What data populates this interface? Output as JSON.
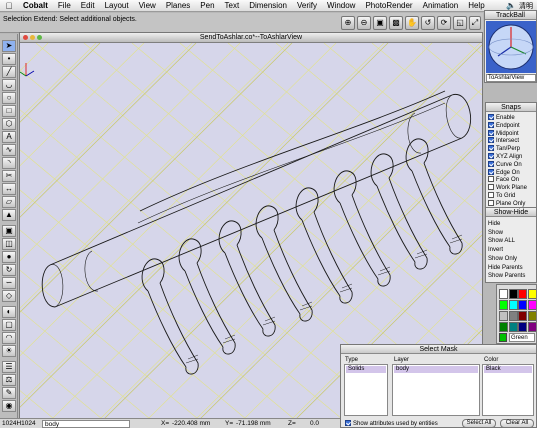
{
  "menubar": {
    "apple": "",
    "app": "Cobalt",
    "items": [
      "File",
      "Edit",
      "Layout",
      "View",
      "Planes",
      "Pen",
      "Text",
      "Dimension",
      "Verify",
      "Window",
      "PhotoRender",
      "Animation",
      "Help"
    ],
    "user": "清明"
  },
  "status": {
    "message": "Selection Extend: Select additional objects."
  },
  "window": {
    "title": "SendToAshlar.co*--ToAshlarView"
  },
  "trackball": {
    "title": "TrackBall",
    "view": "ToAshlarView"
  },
  "snaps": {
    "title": "Snaps",
    "items": [
      {
        "label": "Enable",
        "on": true
      },
      {
        "label": "Endpoint",
        "on": true
      },
      {
        "label": "Midpoint",
        "on": true
      },
      {
        "label": "Intersect",
        "on": true
      },
      {
        "label": "Tan/Perp",
        "on": true
      },
      {
        "label": "XYZ Align",
        "on": true
      },
      {
        "label": "Curve On",
        "on": true
      },
      {
        "label": "Edge On",
        "on": true
      },
      {
        "label": "Face On",
        "on": false
      },
      {
        "label": "Work Plane",
        "on": false
      },
      {
        "label": "To Grid",
        "on": false
      },
      {
        "label": "Plane Only",
        "on": false
      }
    ]
  },
  "showhide": {
    "title": "Show-Hide",
    "items": [
      "Hide",
      "Show",
      "Show ALL",
      "Invert",
      "Show Only",
      "Hide Parents",
      "Show Parents"
    ]
  },
  "colors": {
    "swatches": [
      "#ffffff",
      "#000000",
      "#ff0000",
      "#ffff00",
      "#00ff00",
      "#00ffff",
      "#0000ff",
      "#ff00ff",
      "#c0c0c0",
      "#808080",
      "#800000",
      "#808000",
      "#008000",
      "#008080",
      "#000080",
      "#800080"
    ],
    "current_name": "Green",
    "current_color": "#00c000"
  },
  "selectmask": {
    "title": "Select Mask",
    "col_type": "Type",
    "col_layer": "Layer",
    "col_color": "Color",
    "type_value": "Solids",
    "layer_value": "body",
    "color_value": "Black",
    "checkbox_label": "Show attributes used by entities",
    "select_all": "Select All",
    "clear_all": "Clear All"
  },
  "bottombar": {
    "size": "1024H1024",
    "layer": "body",
    "x_label": "X=",
    "x_value": "-220.408 mm",
    "y_label": "Y=",
    "y_value": "-71.198 mm",
    "z_label": "Z=",
    "z_value": "0.0"
  },
  "accent": "#3a6fd8"
}
